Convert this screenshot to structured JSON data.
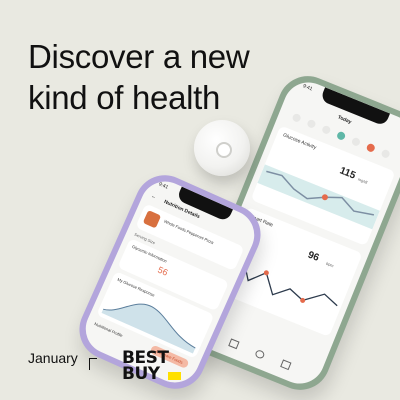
{
  "headline": {
    "line1": "Discover a new",
    "line2": "kind of health"
  },
  "brands": {
    "january": "January",
    "bestbuy_line1": "BEST",
    "bestbuy_line2": "BUY"
  },
  "phone_right": {
    "status_time": "9:41",
    "title": "Today",
    "glucose_section": "Glucose Activity",
    "glucose_value": "115",
    "glucose_unit": "mg/dl",
    "heart_section": "Heart Rate",
    "heart_value": "96",
    "heart_unit": "bpm"
  },
  "phone_left": {
    "status_time": "9:41",
    "title": "Nutrition Details",
    "food_name": "Whole Foods Pepperoni Pizza",
    "serving": "Serving Size",
    "section": "Glycemic Information",
    "value": "56",
    "curve_section": "My Glucose Response",
    "profile": "Nutritional Profile",
    "button": "Compare Foods"
  }
}
